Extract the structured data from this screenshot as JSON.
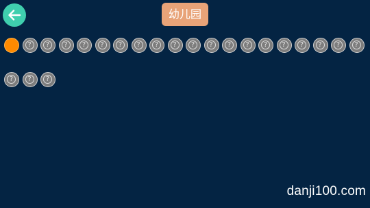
{
  "header": {
    "title": "幼儿园",
    "back_icon": "arrow-left-icon"
  },
  "levels": {
    "items": [
      {
        "state": "current",
        "mark": ""
      },
      {
        "state": "locked",
        "mark": "?"
      },
      {
        "state": "locked",
        "mark": "?"
      },
      {
        "state": "locked",
        "mark": "?"
      },
      {
        "state": "locked",
        "mark": "?"
      },
      {
        "state": "locked",
        "mark": "?"
      },
      {
        "state": "locked",
        "mark": "?"
      },
      {
        "state": "locked",
        "mark": "?"
      },
      {
        "state": "locked",
        "mark": "?"
      },
      {
        "state": "locked",
        "mark": "?"
      },
      {
        "state": "locked",
        "mark": "?"
      },
      {
        "state": "locked",
        "mark": "?"
      },
      {
        "state": "locked",
        "mark": "?"
      },
      {
        "state": "locked",
        "mark": "?"
      },
      {
        "state": "locked",
        "mark": "?"
      },
      {
        "state": "locked",
        "mark": "?"
      },
      {
        "state": "locked",
        "mark": "?"
      },
      {
        "state": "locked",
        "mark": "?"
      },
      {
        "state": "locked",
        "mark": "?"
      },
      {
        "state": "locked",
        "mark": "?"
      },
      {
        "state": "locked",
        "mark": "?"
      },
      {
        "state": "locked",
        "mark": "?"
      },
      {
        "state": "locked",
        "mark": "?"
      }
    ]
  },
  "watermark": {
    "text": "danji100.com"
  },
  "colors": {
    "background": "#042443",
    "back_button": "#3fcfae",
    "title_badge": "#e8a378",
    "current_level": "#ff8a00",
    "locked_level": "#7d7d7d"
  }
}
